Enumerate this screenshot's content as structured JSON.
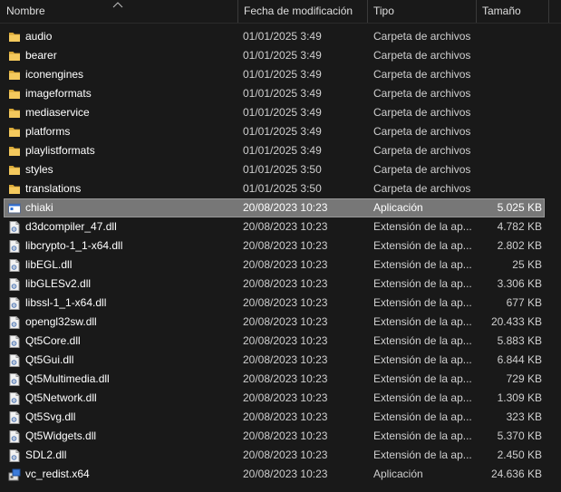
{
  "columns": {
    "name": "Nombre",
    "date": "Fecha de modificación",
    "type": "Tipo",
    "size": "Tamaño"
  },
  "colors": {
    "background": "#191919",
    "selected_row": "#777777",
    "folder": "#e8b84a",
    "text": "#ffffff",
    "secondary_text": "#cfcfcf"
  },
  "rows": [
    {
      "name": "audio",
      "date": "01/01/2025 3:49",
      "type": "Carpeta de archivos",
      "size": "",
      "icon": "folder-icon"
    },
    {
      "name": "bearer",
      "date": "01/01/2025 3:49",
      "type": "Carpeta de archivos",
      "size": "",
      "icon": "folder-icon"
    },
    {
      "name": "iconengines",
      "date": "01/01/2025 3:49",
      "type": "Carpeta de archivos",
      "size": "",
      "icon": "folder-icon"
    },
    {
      "name": "imageformats",
      "date": "01/01/2025 3:49",
      "type": "Carpeta de archivos",
      "size": "",
      "icon": "folder-icon"
    },
    {
      "name": "mediaservice",
      "date": "01/01/2025 3:49",
      "type": "Carpeta de archivos",
      "size": "",
      "icon": "folder-icon"
    },
    {
      "name": "platforms",
      "date": "01/01/2025 3:49",
      "type": "Carpeta de archivos",
      "size": "",
      "icon": "folder-icon"
    },
    {
      "name": "playlistformats",
      "date": "01/01/2025 3:49",
      "type": "Carpeta de archivos",
      "size": "",
      "icon": "folder-icon"
    },
    {
      "name": "styles",
      "date": "01/01/2025 3:50",
      "type": "Carpeta de archivos",
      "size": "",
      "icon": "folder-icon"
    },
    {
      "name": "translations",
      "date": "01/01/2025 3:50",
      "type": "Carpeta de archivos",
      "size": "",
      "icon": "folder-icon"
    },
    {
      "name": "chiaki",
      "date": "20/08/2023 10:23",
      "type": "Aplicación",
      "size": "5.025 KB",
      "icon": "application-icon",
      "selected": true
    },
    {
      "name": "d3dcompiler_47.dll",
      "date": "20/08/2023 10:23",
      "type": "Extensión de la ap...",
      "size": "4.782 KB",
      "icon": "dll-file-icon"
    },
    {
      "name": "libcrypto-1_1-x64.dll",
      "date": "20/08/2023 10:23",
      "type": "Extensión de la ap...",
      "size": "2.802 KB",
      "icon": "dll-file-icon"
    },
    {
      "name": "libEGL.dll",
      "date": "20/08/2023 10:23",
      "type": "Extensión de la ap...",
      "size": "25 KB",
      "icon": "dll-file-icon"
    },
    {
      "name": "libGLESv2.dll",
      "date": "20/08/2023 10:23",
      "type": "Extensión de la ap...",
      "size": "3.306 KB",
      "icon": "dll-file-icon"
    },
    {
      "name": "libssl-1_1-x64.dll",
      "date": "20/08/2023 10:23",
      "type": "Extensión de la ap...",
      "size": "677 KB",
      "icon": "dll-file-icon"
    },
    {
      "name": "opengl32sw.dll",
      "date": "20/08/2023 10:23",
      "type": "Extensión de la ap...",
      "size": "20.433 KB",
      "icon": "dll-file-icon"
    },
    {
      "name": "Qt5Core.dll",
      "date": "20/08/2023 10:23",
      "type": "Extensión de la ap...",
      "size": "5.883 KB",
      "icon": "dll-file-icon"
    },
    {
      "name": "Qt5Gui.dll",
      "date": "20/08/2023 10:23",
      "type": "Extensión de la ap...",
      "size": "6.844 KB",
      "icon": "dll-file-icon"
    },
    {
      "name": "Qt5Multimedia.dll",
      "date": "20/08/2023 10:23",
      "type": "Extensión de la ap...",
      "size": "729 KB",
      "icon": "dll-file-icon"
    },
    {
      "name": "Qt5Network.dll",
      "date": "20/08/2023 10:23",
      "type": "Extensión de la ap...",
      "size": "1.309 KB",
      "icon": "dll-file-icon"
    },
    {
      "name": "Qt5Svg.dll",
      "date": "20/08/2023 10:23",
      "type": "Extensión de la ap...",
      "size": "323 KB",
      "icon": "dll-file-icon"
    },
    {
      "name": "Qt5Widgets.dll",
      "date": "20/08/2023 10:23",
      "type": "Extensión de la ap...",
      "size": "5.370 KB",
      "icon": "dll-file-icon"
    },
    {
      "name": "SDL2.dll",
      "date": "20/08/2023 10:23",
      "type": "Extensión de la ap...",
      "size": "2.450 KB",
      "icon": "dll-file-icon"
    },
    {
      "name": "vc_redist.x64",
      "date": "20/08/2023 10:23",
      "type": "Aplicación",
      "size": "24.636 KB",
      "icon": "installer-icon"
    }
  ]
}
